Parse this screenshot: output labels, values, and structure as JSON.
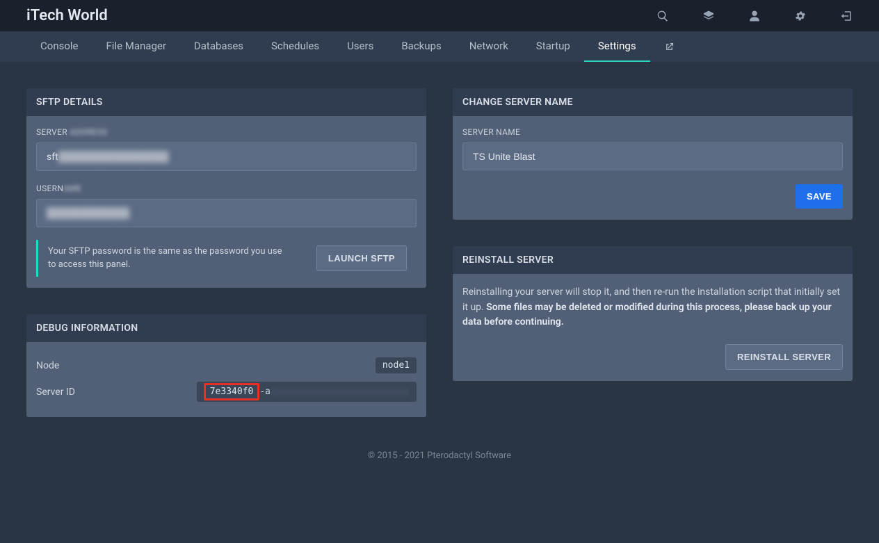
{
  "brand": "iTech World",
  "topIcons": [
    "search",
    "layers",
    "user",
    "gears",
    "logout"
  ],
  "nav": {
    "items": [
      "Console",
      "File Manager",
      "Databases",
      "Schedules",
      "Users",
      "Backups",
      "Network",
      "Startup",
      "Settings"
    ],
    "activeIndex": 8
  },
  "sftp": {
    "panelTitle": "SFTP DETAILS",
    "addressLabel": "SERVER ",
    "addressLabelBlur": "ADDRESS",
    "addressValuePrefix": "sft",
    "addressValueHidden": "████████████████",
    "usernameLabel": "USERN",
    "usernameLabelBlur": "AME",
    "usernameHidden": "████████████",
    "note": "Your SFTP password is the same as the password you use to access this panel.",
    "launchBtn": "LAUNCH SFTP"
  },
  "changeName": {
    "panelTitle": "CHANGE SERVER NAME",
    "fieldLabel": "SERVER NAME",
    "value": "TS Unite Blast",
    "saveBtn": "SAVE"
  },
  "reinstall": {
    "panelTitle": "REINSTALL SERVER",
    "text1": "Reinstalling your server will stop it, and then re-run the installation script that initially set it up. ",
    "text2": "Some files may be deleted or modified during this process, please back up your data before continuing.",
    "btn": "REINSTALL SERVER"
  },
  "debug": {
    "panelTitle": "DEBUG INFORMATION",
    "nodeLabel": "Node",
    "nodeValue": "node1",
    "serverIdLabel": "Server ID",
    "serverIdHighlighted": "7e3340f0",
    "serverIdSep": "-a"
  },
  "footer": "© 2015 - 2021 Pterodactyl Software"
}
